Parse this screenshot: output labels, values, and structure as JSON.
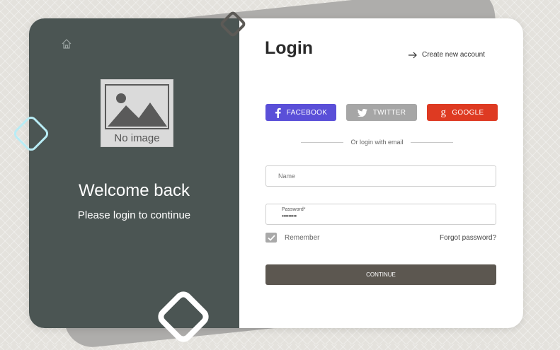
{
  "left_panel": {
    "welcome": "Welcome back",
    "subtitle": "Please login to continue",
    "placeholder_text": "No image"
  },
  "form": {
    "title": "Login",
    "create_account": "Create new account",
    "social": {
      "facebook": "FACEBOOK",
      "twitter": "TWITTER",
      "google": "GOOGLE"
    },
    "or_text": "Or login with email",
    "name_placeholder": "Name",
    "password_label": "Password*",
    "password_value": "•••••••••",
    "remember": "Remember",
    "forgot": "Forgot password?",
    "continue": "CONTINUE"
  },
  "colors": {
    "panel": "#4b5553",
    "facebook": "#5a4fd8",
    "twitter": "#a6a6a6",
    "google": "#de3a22",
    "continue": "#5c5750"
  },
  "icons": [
    "home-icon",
    "arrow-right-icon",
    "facebook-icon",
    "twitter-icon",
    "google-icon",
    "checkmark-icon"
  ]
}
